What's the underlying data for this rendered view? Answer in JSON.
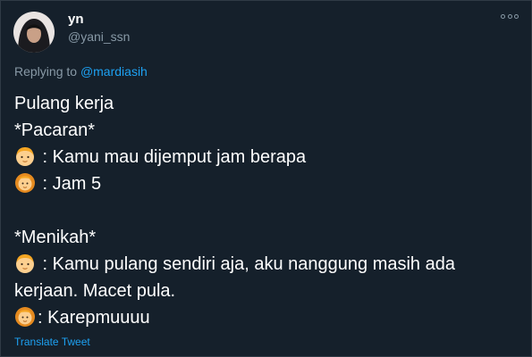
{
  "tweet": {
    "display_name": "yn",
    "handle": "@yani_ssn",
    "replying_prefix": "Replying to ",
    "replying_to": "@mardiasih",
    "lines": [
      {
        "emoji": "",
        "text": "Pulang kerja"
      },
      {
        "emoji": "",
        "text": "*Pacaran*"
      },
      {
        "emoji": "boy-face",
        "text": " : Kamu mau dijemput jam berapa"
      },
      {
        "emoji": "lion-face",
        "text": " : Jam 5"
      },
      {
        "emoji": "",
        "text": ""
      },
      {
        "emoji": "",
        "text": "*Menikah*"
      },
      {
        "emoji": "boy-face",
        "text": " : Kamu pulang sendiri aja, aku nanggung masih ada"
      },
      {
        "emoji": "",
        "text": "kerjaan. Macet pula."
      },
      {
        "emoji": "lion-face",
        "text": ": Karepmuuuu"
      }
    ],
    "translate_label": "Translate Tweet"
  },
  "colors": {
    "background": "#15202b",
    "text": "#ffffff",
    "muted": "#8899a6",
    "link": "#1da1f2"
  },
  "icons": {
    "avatar": "profile-photo",
    "more": "more-dots-icon"
  }
}
